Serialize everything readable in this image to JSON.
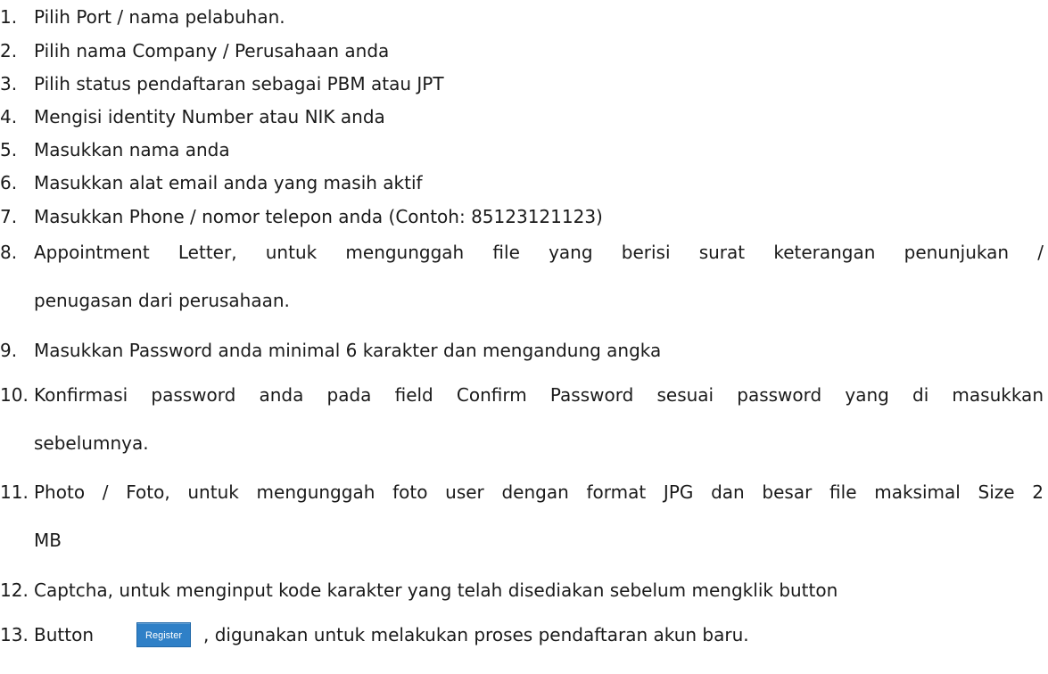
{
  "list": [
    {
      "num": "1.",
      "lines": [
        "Pilih Port / nama pelabuhan."
      ]
    },
    {
      "num": "2.",
      "lines": [
        "Pilih nama Company / Perusahaan anda"
      ]
    },
    {
      "num": "3.",
      "lines": [
        "Pilih status pendaftaran sebagai PBM atau JPT"
      ]
    },
    {
      "num": "4.",
      "lines": [
        "Mengisi identity Number atau NIK anda"
      ]
    },
    {
      "num": "5.",
      "lines": [
        "Masukkan nama anda"
      ]
    },
    {
      "num": "6.",
      "lines": [
        "Masukkan alat email anda yang masih aktif"
      ]
    },
    {
      "num": "7.",
      "lines": [
        "Masukkan Phone / nomor telepon anda (Contoh: 85123121123)"
      ]
    },
    {
      "num": "8.",
      "lines": [
        "Appointment Letter, untuk mengunggah file yang berisi surat keterangan penunjukan /",
        "penugasan dari perusahaan."
      ]
    },
    {
      "num": "9.",
      "lines": [
        "Masukkan Password anda minimal 6 karakter dan mengandung angka"
      ]
    },
    {
      "num": "10.",
      "lines": [
        "Konfirmasi password anda pada field Confirm Password sesuai password yang di masukkan",
        "sebelumnya."
      ]
    },
    {
      "num": "11.",
      "lines": [
        "Photo / Foto, untuk mengunggah foto user dengan format JPG dan besar file maksimal Size 2",
        "MB"
      ]
    },
    {
      "num": "12.",
      "lines": [
        "Captcha, untuk menginput kode karakter yang telah disediakan sebelum mengklik button"
      ]
    },
    {
      "num": "13.",
      "lines": [
        "Button",
        ", digunakan untuk melakukan proses pendaftaran akun baru."
      ],
      "button_label": "Register"
    }
  ],
  "colors": {
    "text": "#1a1a1a",
    "register_button_bg": "#2f80c7",
    "register_button_text": "#ffffff"
  }
}
